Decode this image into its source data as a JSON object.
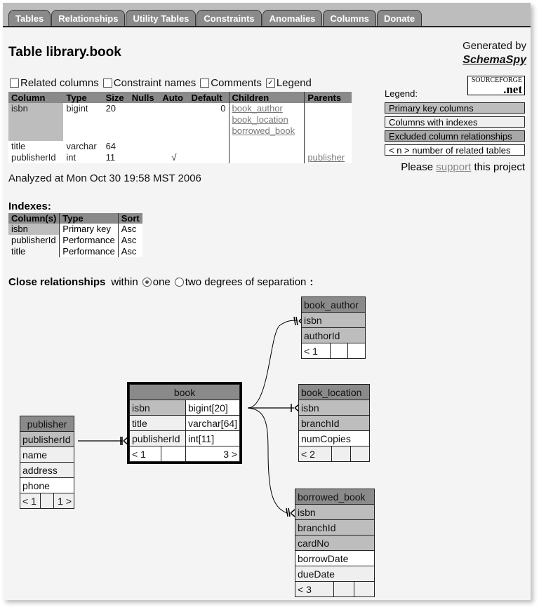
{
  "tabs": [
    "Tables",
    "Relationships",
    "Utility Tables",
    "Constraints",
    "Anomalies",
    "Columns",
    "Donate"
  ],
  "header": {
    "title": "Table library.book",
    "generated_by": "Generated by",
    "tool": "SchemaSpy"
  },
  "options": [
    {
      "label": "Related columns",
      "checked": false
    },
    {
      "label": "Constraint names",
      "checked": false
    },
    {
      "label": "Comments",
      "checked": false
    },
    {
      "label": "Legend",
      "checked": true
    }
  ],
  "columns_table": {
    "headers": [
      "Column",
      "Type",
      "Size",
      "Nulls",
      "Auto",
      "Default",
      "Children",
      "Parents"
    ],
    "rows": [
      {
        "column": "isbn",
        "type": "bigint",
        "size": "20",
        "nulls": "",
        "auto": "",
        "default": "0",
        "children": [
          "book_author",
          "book_location",
          "borrowed_book"
        ],
        "parents": []
      },
      {
        "column": "title",
        "type": "varchar",
        "size": "64",
        "nulls": "",
        "auto": "",
        "default": "",
        "children": [],
        "parents": []
      },
      {
        "column": "publisherId",
        "type": "int",
        "size": "11",
        "nulls": "",
        "auto": "√",
        "default": "",
        "children": [],
        "parents": [
          "publisher"
        ]
      }
    ]
  },
  "legend": {
    "label": "Legend:",
    "logo_top": "SOURCEFORGE",
    "logo_bottom": ".net",
    "items": [
      "Primary key columns",
      "Columns with indexes",
      "Excluded column relationships",
      "< n > number of related tables"
    ],
    "support_prefix": "Please",
    "support_link": "support",
    "support_suffix": "this project"
  },
  "analyzed": "Analyzed at Mon Oct 30 19:58 MST 2006",
  "indexes": {
    "heading": "Indexes:",
    "headers": [
      "Column(s)",
      "Type",
      "Sort"
    ],
    "rows": [
      {
        "column": "isbn",
        "type": "Primary key",
        "sort": "Asc"
      },
      {
        "column": "publisherId",
        "type": "Performance",
        "sort": "Asc"
      },
      {
        "column": "title",
        "type": "Performance",
        "sort": "Asc"
      }
    ]
  },
  "close_relationships": {
    "label": "Close relationships",
    "within": "within",
    "option_one": "one",
    "option_two": "two degrees of separation",
    "suffix": ":",
    "selected": "one"
  },
  "diagram": {
    "book": {
      "name": "book",
      "rows": [
        [
          "isbn",
          "bigint[20]"
        ],
        [
          "title",
          "varchar[64]"
        ],
        [
          "publisherId",
          "int[11]"
        ]
      ],
      "parents": "< 1",
      "children": "3 >"
    },
    "publisher": {
      "name": "publisher",
      "rows": [
        "publisherId",
        "name",
        "address",
        "phone"
      ],
      "parents": "< 1",
      "children": "1 >"
    },
    "book_author": {
      "name": "book_author",
      "rows": [
        "isbn",
        "authorId"
      ],
      "parents": "< 1"
    },
    "book_location": {
      "name": "book_location",
      "rows": [
        "isbn",
        "branchId",
        "numCopies"
      ],
      "parents": "< 2"
    },
    "borrowed_book": {
      "name": "borrowed_book",
      "rows": [
        "isbn",
        "branchId",
        "cardNo",
        "borrowDate",
        "dueDate"
      ],
      "parents": "< 3"
    }
  }
}
